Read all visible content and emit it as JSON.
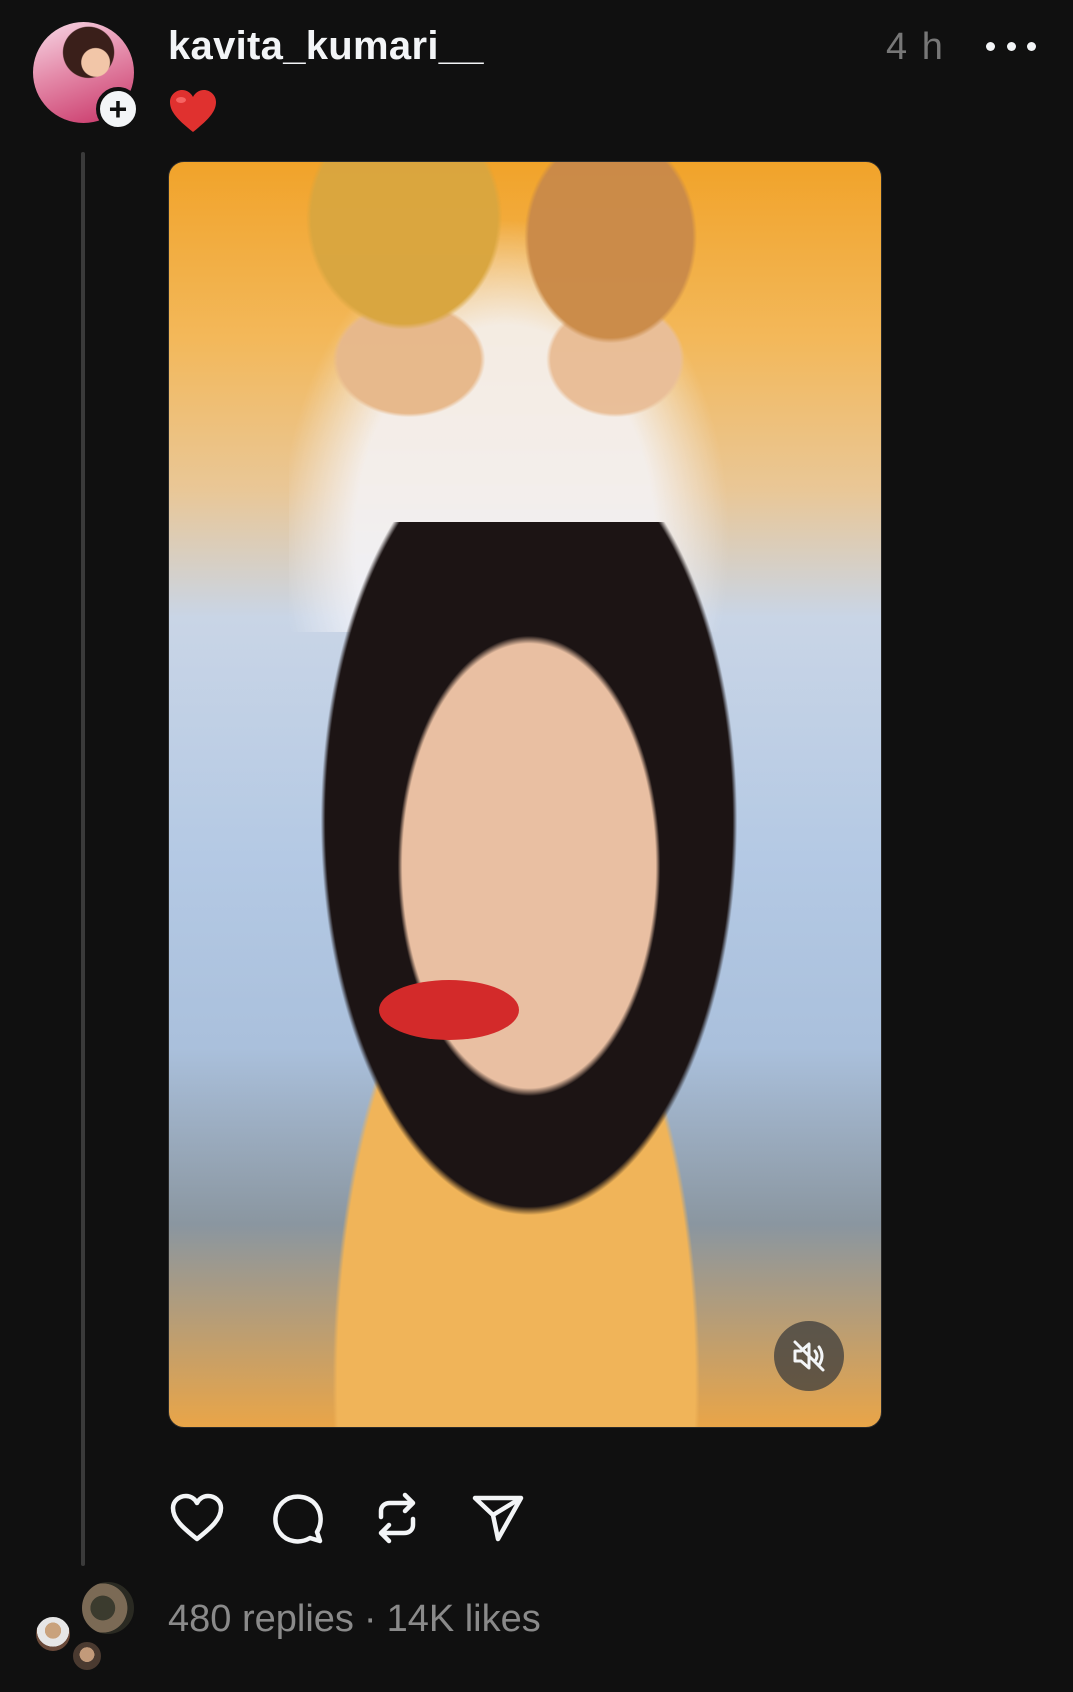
{
  "post": {
    "username": "kavita_kumari__",
    "timestamp": "4 h",
    "caption_emoji": "heart-emoji",
    "media": {
      "type": "video",
      "muted": true
    }
  },
  "stats": {
    "replies": "480 replies",
    "separator": "·",
    "likes": "14K likes"
  },
  "icons": {
    "like": "heart-icon",
    "reply": "comment-icon",
    "repost": "repost-icon",
    "share": "send-icon",
    "mute": "speaker-muted-icon",
    "more": "more-dots-icon",
    "follow": "plus-icon"
  },
  "colors": {
    "background": "#101010",
    "text": "#f3f5f7",
    "muted_text": "#777777",
    "heart": "#e0312f"
  }
}
